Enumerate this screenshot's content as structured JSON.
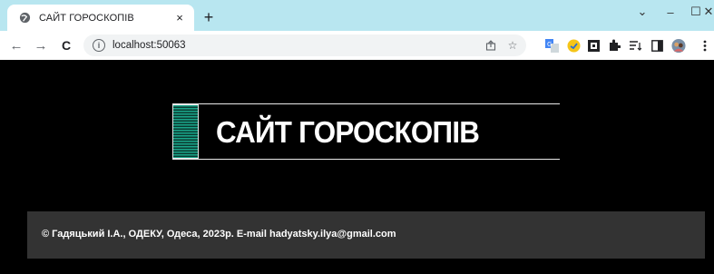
{
  "browser": {
    "tab": {
      "title": "САЙТ ГОРОСКОПІВ",
      "close_glyph": "×",
      "favicon": "globe-icon"
    },
    "new_tab_glyph": "+",
    "window_controls": {
      "collapse": "⌄",
      "minimize": "–",
      "maximize": "☐",
      "close": "✕"
    },
    "nav": {
      "back": "←",
      "forward": "→",
      "reload": "C"
    },
    "address": {
      "url": "localhost:50063",
      "info_glyph": "i"
    },
    "omnibox_icons": [
      "share-icon",
      "star-icon"
    ],
    "extension_icons": [
      "translate-icon",
      "extension-yellow-icon",
      "qr-icon",
      "puzzle-icon",
      "reading-list-icon",
      "side-panel-icon",
      "profile-avatar-icon",
      "menu-icon"
    ]
  },
  "page": {
    "title": "САЙТ ГОРОСКОПІВ",
    "footer": "© Гадяцький І.А., ОДЕКУ, Одеса, 2023р. E-mail hadyatsky.ilya@gmail.com"
  },
  "colors": {
    "tabstrip": "#b8e6f0",
    "page_background": "#000000",
    "footer_background": "#333333",
    "stripe_accent": "#1aa58a"
  }
}
